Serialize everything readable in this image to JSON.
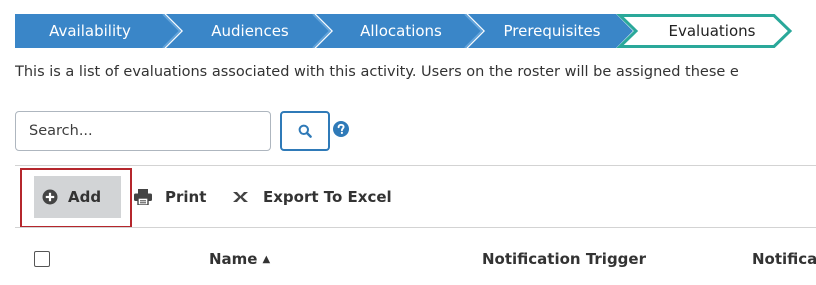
{
  "wizard": {
    "steps": [
      {
        "label": "Availability"
      },
      {
        "label": "Audiences"
      },
      {
        "label": "Allocations"
      },
      {
        "label": "Prerequisites"
      },
      {
        "label": "Evaluations",
        "active": true
      }
    ]
  },
  "description": "This is a list of evaluations associated with this activity. Users on the roster will be assigned these e",
  "search": {
    "placeholder": "Search...",
    "value": ""
  },
  "toolbar": {
    "add_label": "Add",
    "print_label": "Print",
    "export_label": "Export To Excel"
  },
  "table": {
    "columns": [
      {
        "label": "Name",
        "sort_indicator": "▲"
      },
      {
        "label": "Notification Trigger"
      },
      {
        "label": "Notifica"
      }
    ]
  },
  "colors": {
    "step_blue": "#3a86c8",
    "active_step_border": "#2aa89a",
    "highlight_red": "#b5262c",
    "search_button_border": "#2f7ab8"
  },
  "icons": {
    "search": "search-icon",
    "help": "help-icon",
    "add": "plus-circle-icon",
    "print": "printer-icon",
    "export": "excel-icon"
  }
}
